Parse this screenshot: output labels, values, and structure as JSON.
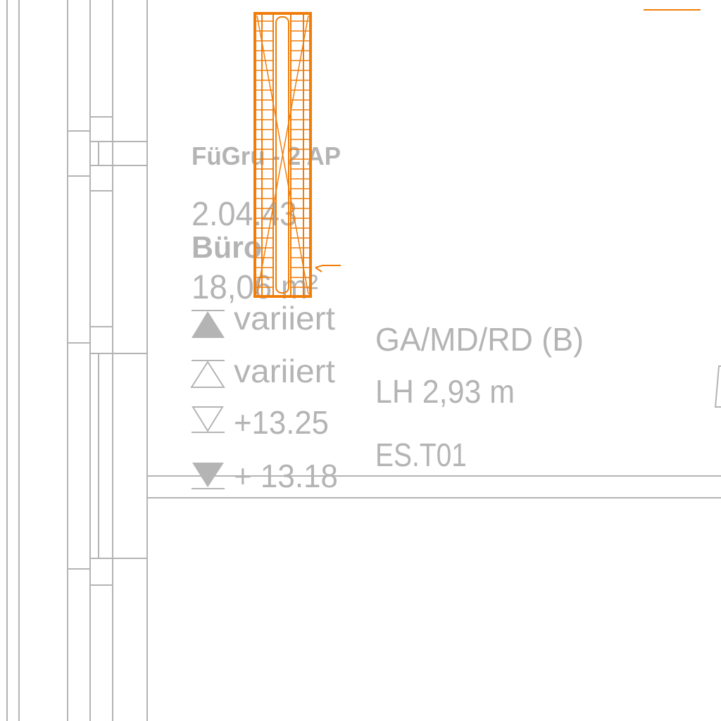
{
  "colors": {
    "linework": "#b4b4b4",
    "highlight": "#f07d0a",
    "background": "#ffffff"
  },
  "room": {
    "group_label": "FüGru - 2 AP",
    "number": "2.04.43",
    "name": "Büro",
    "area": "18,06 m²"
  },
  "levels": [
    {
      "symbol": "filled-up-triangle",
      "value": "variiert"
    },
    {
      "symbol": "outline-up-triangle",
      "value": "variiert"
    },
    {
      "symbol": "outline-down-triangle",
      "value": "+13.25"
    },
    {
      "symbol": "filled-down-triangle",
      "value": "+ 13.18"
    }
  ],
  "info": {
    "code": "GA/MD/RD (B)",
    "clear_height": "LH 2,93 m",
    "designation": "ES.T01"
  }
}
